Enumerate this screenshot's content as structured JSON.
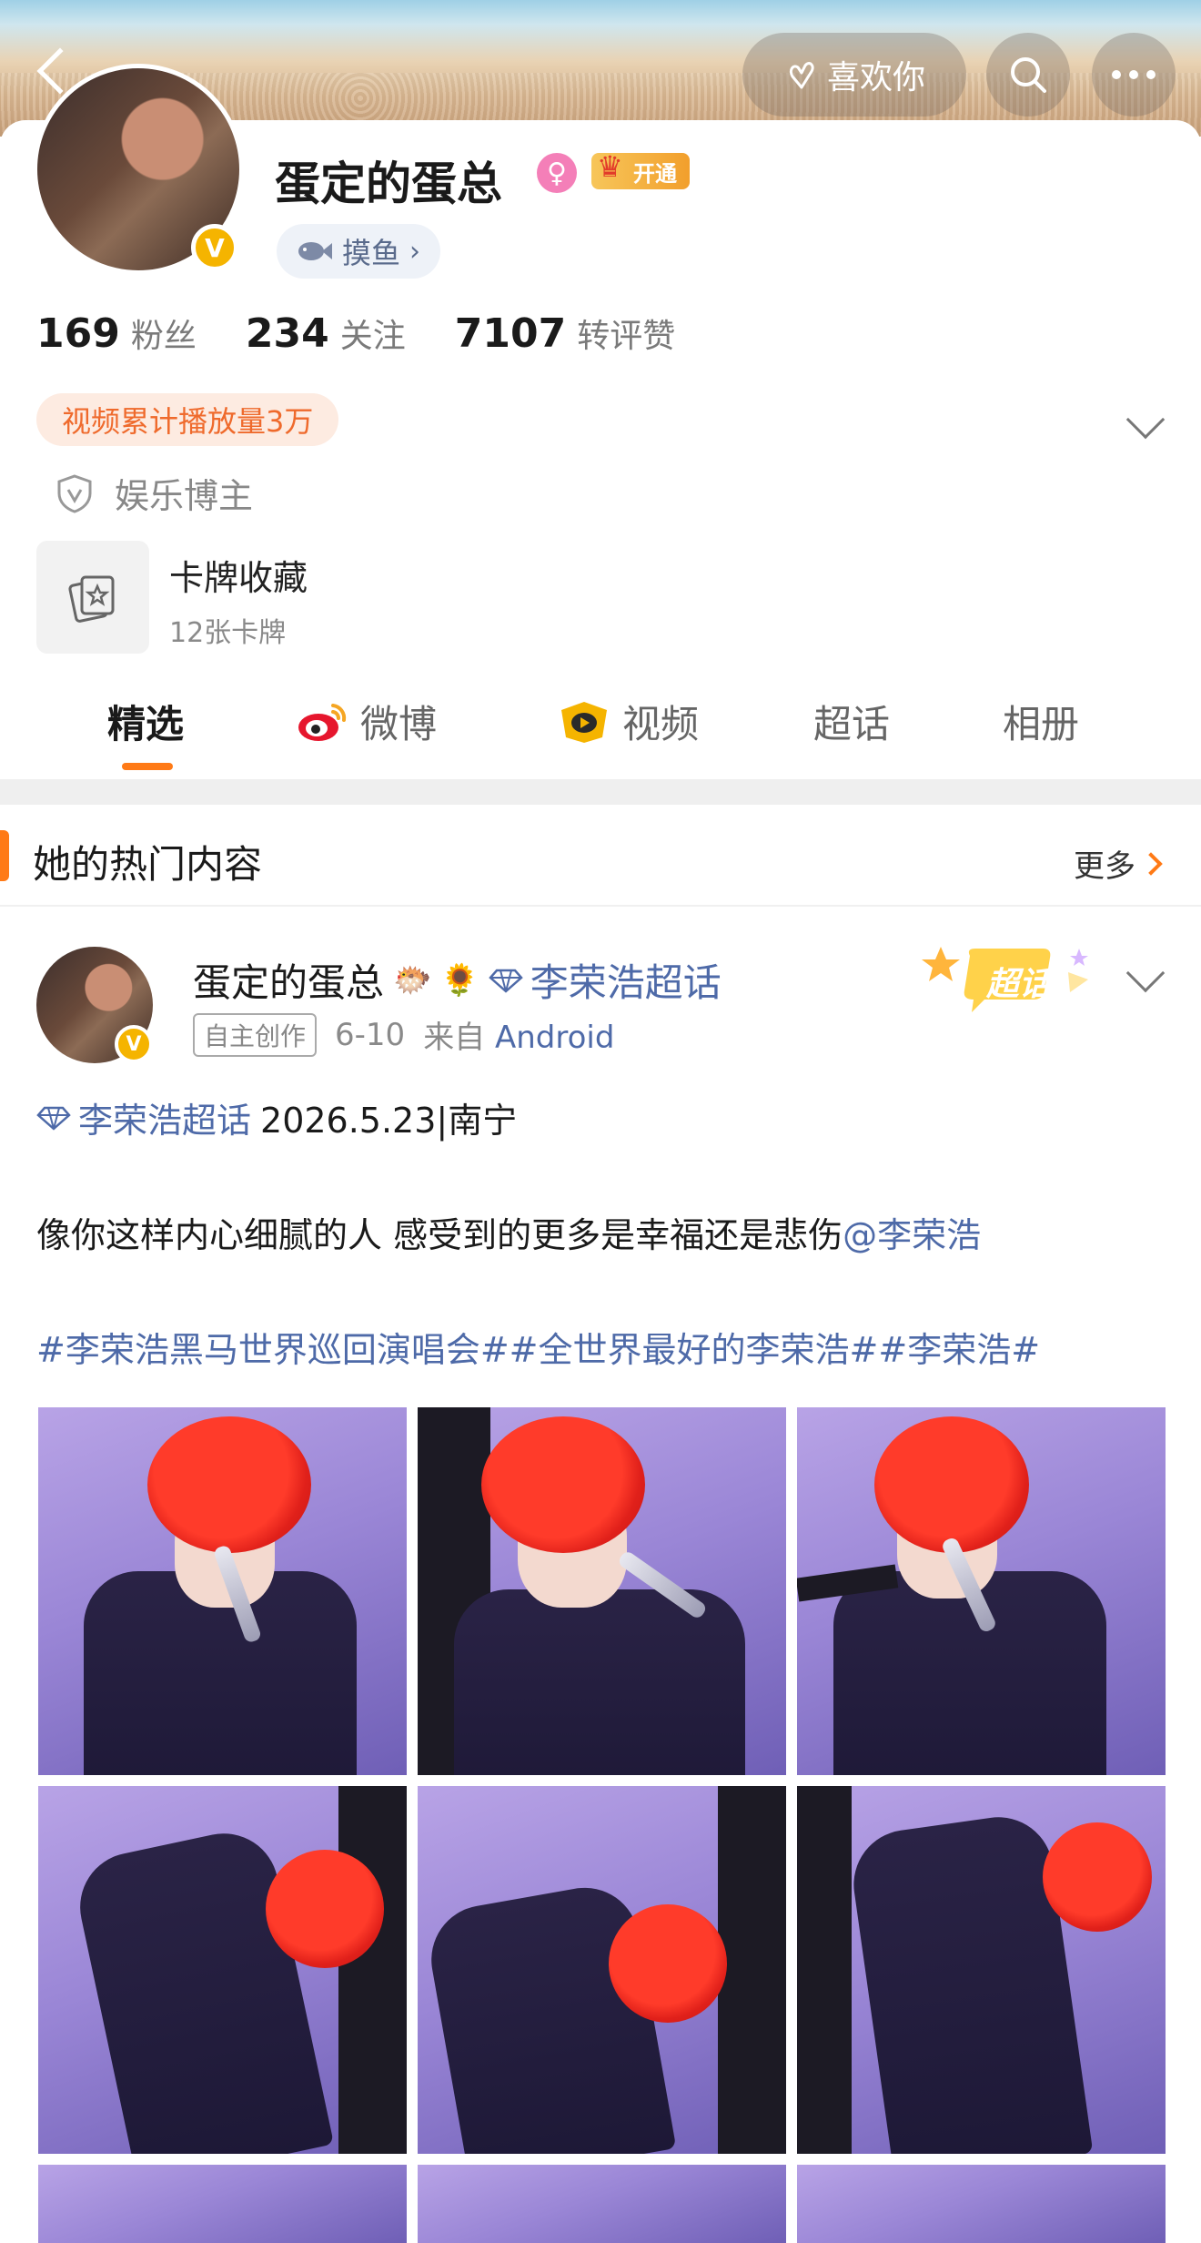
{
  "header": {
    "like_label": "喜欢你"
  },
  "profile": {
    "name": "蛋定的蛋总",
    "vip_label": "开通",
    "verified_mark": "V",
    "tag_chip": "摸鱼",
    "stats": [
      {
        "num": "169",
        "label": "粉丝"
      },
      {
        "num": "234",
        "label": "关注"
      },
      {
        "num": "7107",
        "label": "转评赞"
      }
    ],
    "play_badge": "视频累计播放量3万",
    "certification": "娱乐博主",
    "cards_title": "卡牌收藏",
    "cards_sub": "12张卡牌"
  },
  "tabs": [
    {
      "label": "精选",
      "active": true
    },
    {
      "label": "微博",
      "icon": "weibo-icon"
    },
    {
      "label": "视频",
      "icon": "video-icon"
    },
    {
      "label": "超话"
    },
    {
      "label": "相册"
    }
  ],
  "section": {
    "title": "她的热门内容",
    "more": "更多"
  },
  "post": {
    "author": "蛋定的蛋总",
    "topic": "李荣浩超话",
    "original_tag": "自主创作",
    "date": "6-10",
    "from_prefix": "来自",
    "from_source": "Android",
    "super_badge": "超话",
    "line1_topic": "李荣浩超话",
    "line1_text": "2026.5.23|南宁",
    "line2_text": "像你这样内心细腻的人 感受到的更多是幸福还是悲伤",
    "line2_mention": "@李荣浩",
    "line3_text": "#李荣浩黑马世界巡回演唱会##全世界最好的李荣浩##李荣浩#"
  },
  "colors": {
    "accent": "#ff7a16",
    "link": "#4e6aa8",
    "vip_gold": "#f29f2c",
    "verified": "#f5b400"
  }
}
